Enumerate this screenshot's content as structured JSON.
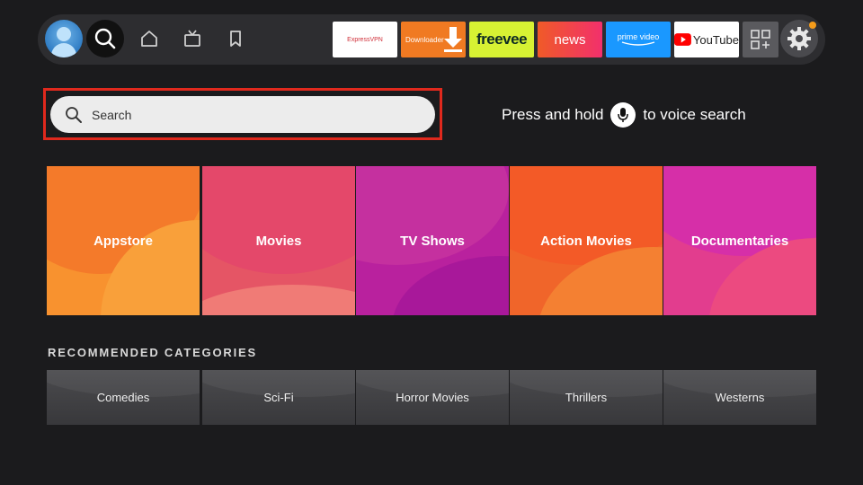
{
  "top_nav": {
    "profile": "avatar",
    "items": [
      {
        "name": "search",
        "icon": "search-icon",
        "active": true
      },
      {
        "name": "home",
        "icon": "home-icon"
      },
      {
        "name": "live-tv",
        "icon": "tv-icon"
      },
      {
        "name": "watchlist",
        "icon": "bookmark-icon"
      }
    ],
    "apps": [
      {
        "label": "ExpressVPN"
      },
      {
        "label": "Downloader"
      },
      {
        "label": "freevee"
      },
      {
        "label": "news"
      },
      {
        "label": "prime video"
      },
      {
        "label": "YouTube"
      }
    ],
    "apps_icon": "apps-grid-icon",
    "settings_icon": "gear-icon",
    "notification_color": "#f59c1a"
  },
  "search": {
    "placeholder": "Search",
    "focus_color": "#e0291d",
    "voice_hint_prefix": "Press and hold",
    "voice_hint_suffix": "to voice search"
  },
  "categories": [
    {
      "label": "Appstore"
    },
    {
      "label": "Movies"
    },
    {
      "label": "TV Shows"
    },
    {
      "label": "Action Movies"
    },
    {
      "label": "Documentaries"
    }
  ],
  "recommended": {
    "title": "RECOMMENDED CATEGORIES",
    "items": [
      {
        "label": "Comedies"
      },
      {
        "label": "Sci-Fi"
      },
      {
        "label": "Horror Movies"
      },
      {
        "label": "Thrillers"
      },
      {
        "label": "Westerns"
      }
    ]
  }
}
